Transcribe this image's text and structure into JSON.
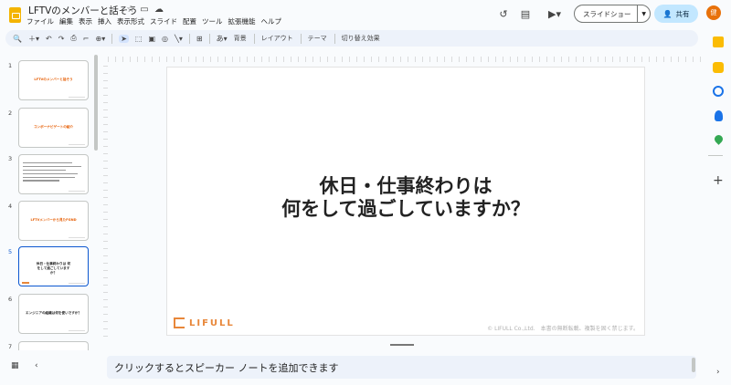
{
  "app": {
    "doc_title": "LFTVのメンバーと話そう",
    "title_icons": [
      "star-icon",
      "move-folder-icon",
      "cloud-status-icon"
    ],
    "menu": [
      "ファイル",
      "編集",
      "表示",
      "挿入",
      "表示形式",
      "スライド",
      "配置",
      "ツール",
      "拡張機能",
      "ヘルプ"
    ]
  },
  "header": {
    "icons": [
      "history-icon",
      "comment-icon",
      "meet-icon"
    ],
    "slideshow_label": "スライドショー",
    "share_label": "共有",
    "avatar_initial": "健"
  },
  "toolbar": {
    "background_label": "背景",
    "layout_label": "レイアウト",
    "theme_label": "テーマ",
    "transition_label": "切り替え効果"
  },
  "filmstrip": {
    "slides": [
      {
        "num": "1",
        "text": "LFTVのメンバーと話そう",
        "style": "orange"
      },
      {
        "num": "2",
        "text": "コンポーナビゲートの紹介",
        "style": "orange"
      },
      {
        "num": "3",
        "text": "",
        "style": "list"
      },
      {
        "num": "4",
        "text": "LFTVメンバーから見たFGND",
        "style": "orange"
      },
      {
        "num": "5",
        "text": "休日・仕事終わりは 何をして過ごしていますか？",
        "style": "dark",
        "selected": true
      },
      {
        "num": "6",
        "text": "エンジニアの組織は何を使いですか？",
        "style": "dark"
      },
      {
        "num": "7",
        "text": "",
        "style": "blank"
      }
    ]
  },
  "slide": {
    "title_line1": "休日・仕事終わりは",
    "title_line2": "何をして過ごしていますか？",
    "logo_text": "LIFULL",
    "footer_text": "© LIFULL Co.,Ltd.　本書の無断転載、複製を固く禁じます。"
  },
  "notes": {
    "placeholder": "クリックするとスピーカー ノートを追加できます"
  },
  "colors": {
    "accent_blue": "#0b57d0",
    "lifull_orange": "#e8873a",
    "share_bg": "#c2e7ff"
  }
}
